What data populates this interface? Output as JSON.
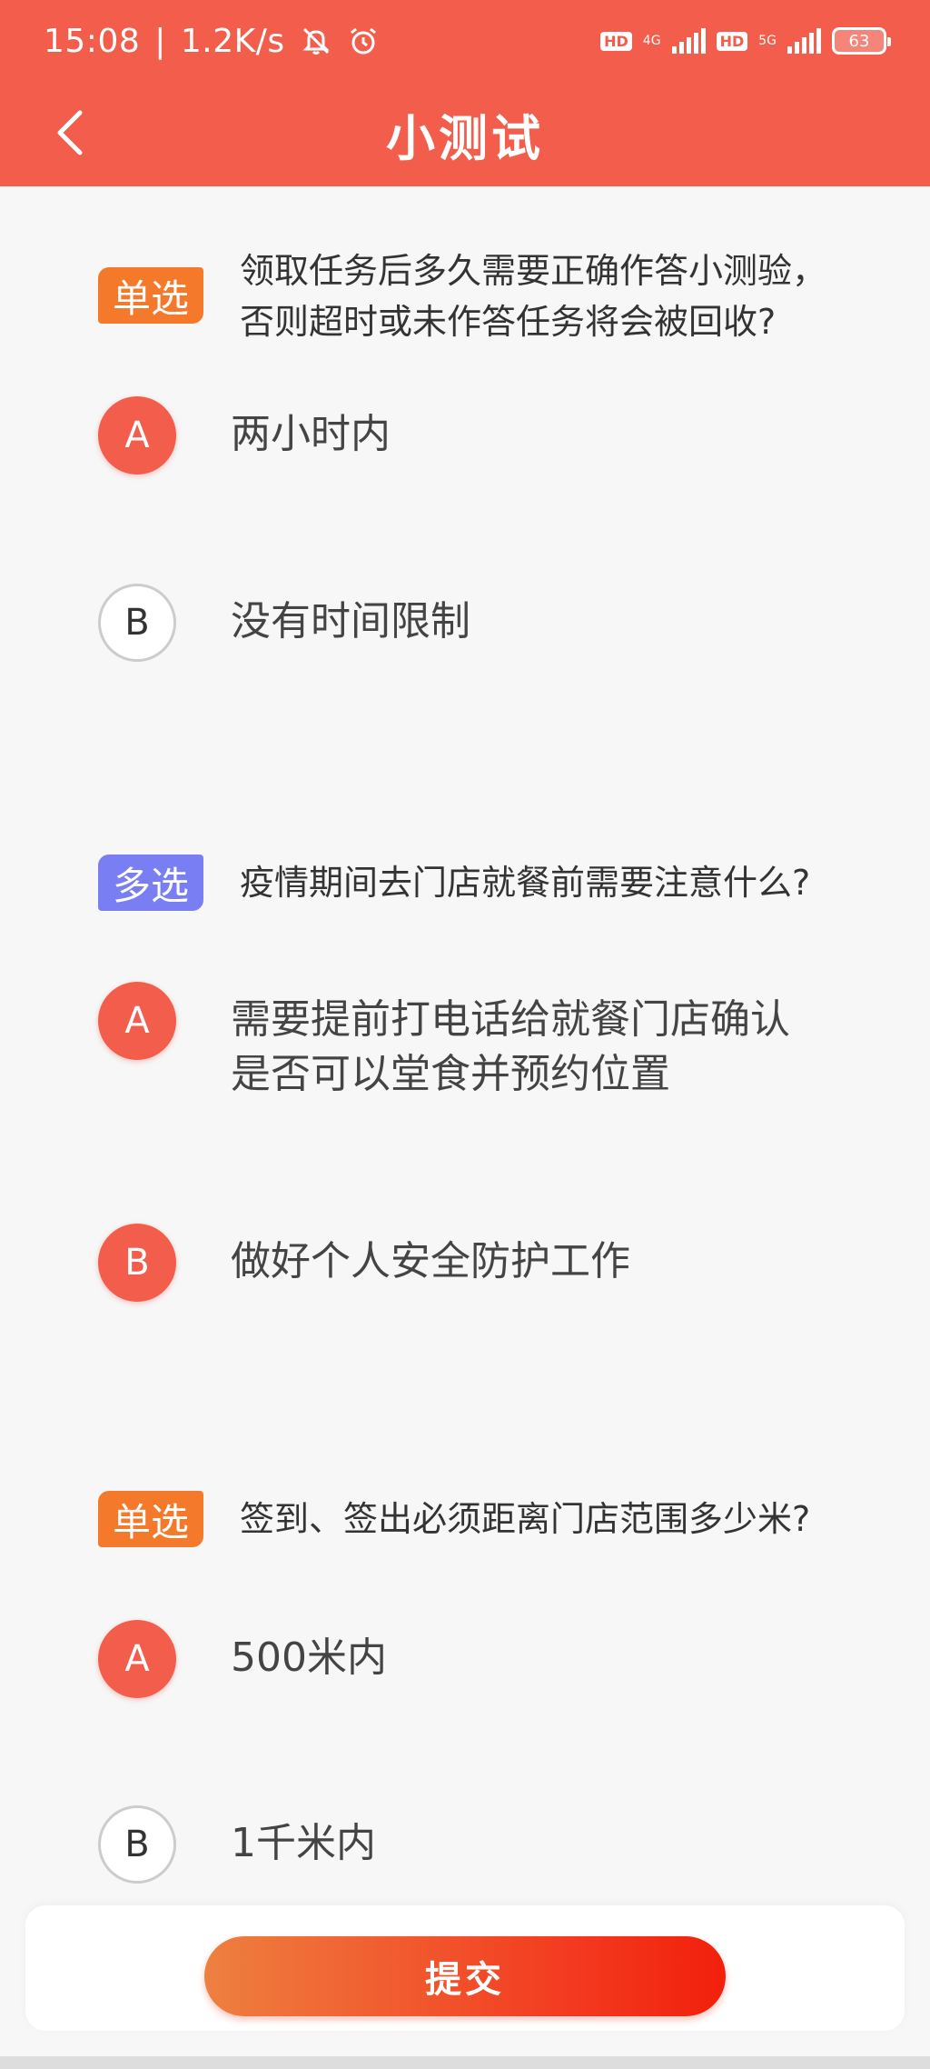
{
  "status_bar": {
    "time": "15:08",
    "speed": "1.2K/s",
    "hd_label": "HD",
    "net_1": "4G",
    "net_2": "5G",
    "battery": "63"
  },
  "nav": {
    "title": "小测试"
  },
  "questions": [
    {
      "type": "单选",
      "text": "领取任务后多久需要正确作答小测验，否则超时或未作答任务将会被回收?",
      "options": [
        {
          "letter": "A",
          "text": "两小时内",
          "selected": true
        },
        {
          "letter": "B",
          "text": "没有时间限制",
          "selected": false
        }
      ]
    },
    {
      "type": "多选",
      "text": "疫情期间去门店就餐前需要注意什么?",
      "options": [
        {
          "letter": "A",
          "text": "需要提前打电话给就餐门店确认是否可以堂食并预约位置",
          "selected": true
        },
        {
          "letter": "B",
          "text": "做好个人安全防护工作",
          "selected": true
        }
      ]
    },
    {
      "type": "单选",
      "text": "签到、签出必须距离门店范围多少米?",
      "options": [
        {
          "letter": "A",
          "text": "500米内",
          "selected": true
        },
        {
          "letter": "B",
          "text": "1千米内",
          "selected": false
        }
      ]
    }
  ],
  "submit": {
    "label": "提交"
  },
  "colors": {
    "primary": "#f25d4c",
    "single_tag": "#f5792a",
    "multi_tag": "#7a7ef3"
  }
}
